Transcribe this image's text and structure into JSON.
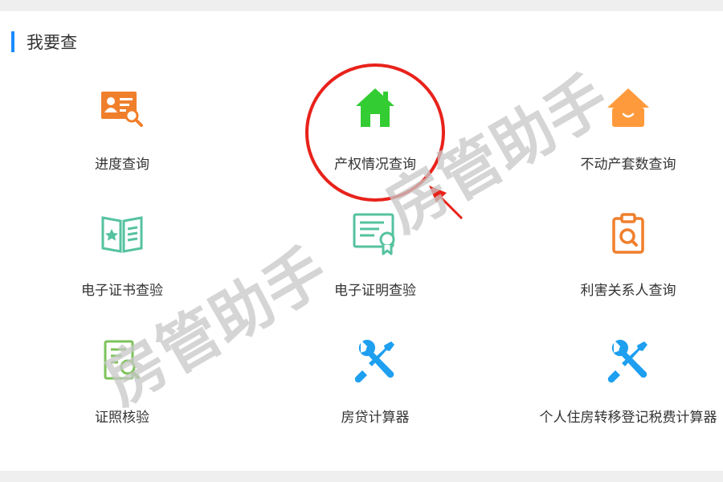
{
  "section": {
    "title": "我要查"
  },
  "items": [
    {
      "label": "进度查询",
      "icon": "id-card-search-icon",
      "color": "#f07f2c"
    },
    {
      "label": "产权情况查询",
      "icon": "house-icon",
      "color": "#33cc33"
    },
    {
      "label": "不动产套数查询",
      "icon": "house-box-icon",
      "color": "#ff9a3c"
    },
    {
      "label": "电子证书查验",
      "icon": "certificate-book-icon",
      "color": "#55c2a0"
    },
    {
      "label": "电子证明查验",
      "icon": "certificate-ribbon-icon",
      "color": "#55c2a0"
    },
    {
      "label": "利害关系人查询",
      "icon": "clipboard-search-icon",
      "color": "#f07f2c"
    },
    {
      "label": "证照核验",
      "icon": "document-search-icon",
      "color": "#7cc35a"
    },
    {
      "label": "房贷计算器",
      "icon": "tools-icon",
      "color": "#1e9ff0"
    },
    {
      "label": "个人住房转移登记税费计算器",
      "icon": "tools-icon",
      "color": "#1e9ff0"
    }
  ],
  "watermark": {
    "text": "房管助手"
  },
  "annotation": {
    "color": "#e8221b"
  }
}
